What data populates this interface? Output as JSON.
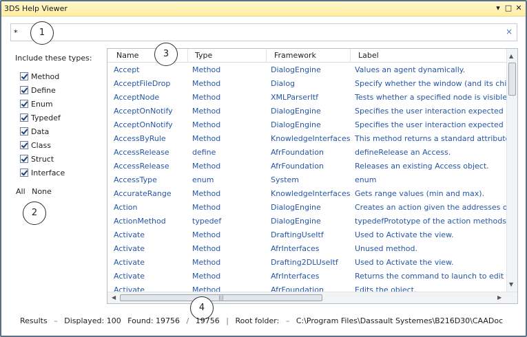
{
  "window": {
    "title": "3DS Help Viewer",
    "pin_glyph": "▾",
    "maximize_glyph": "□",
    "close_glyph": "✕"
  },
  "search": {
    "value": "*",
    "clear_glyph": "×"
  },
  "filters": {
    "title": "Include these types:",
    "types": [
      {
        "label": "Method",
        "checked": true
      },
      {
        "label": "Define",
        "checked": true
      },
      {
        "label": "Enum",
        "checked": true
      },
      {
        "label": "Typedef",
        "checked": true
      },
      {
        "label": "Data",
        "checked": true
      },
      {
        "label": "Class",
        "checked": true
      },
      {
        "label": "Struct",
        "checked": true
      },
      {
        "label": "Interface",
        "checked": true
      }
    ],
    "all_label": "All",
    "none_label": "None"
  },
  "callouts": [
    "1",
    "2",
    "3",
    "4"
  ],
  "grid": {
    "columns": [
      "Name",
      "Type",
      "Framework",
      "Label"
    ],
    "rows": [
      [
        "Accept",
        "Method",
        "DialogEngine",
        "Values an agent dynamically."
      ],
      [
        "AcceptFileDrop",
        "Method",
        "Dialog",
        "Specify whether the window (and its child"
      ],
      [
        "AcceptNode",
        "Method",
        "XMLParserItf",
        "Tests whether a specified node is visible ir"
      ],
      [
        "AcceptOnNotify",
        "Method",
        "DialogEngine",
        "Specifies the user interaction expected by"
      ],
      [
        "AcceptOnNotify",
        "Method",
        "DialogEngine",
        "Specifies the user interaction expected by"
      ],
      [
        "AccessByRule",
        "Method",
        "KnowledgeInterfaces",
        "This method returns a standard attribute a"
      ],
      [
        "AccessRelease",
        "define",
        "AfrFoundation",
        "defineRelease an Access."
      ],
      [
        "AccessRelease",
        "Method",
        "AfrFoundation",
        "Releases an existing Access object."
      ],
      [
        "AccessType",
        "enum",
        "System",
        "enum"
      ],
      [
        "AccurateRange",
        "Method",
        "KnowledgeInterfaces",
        "Gets range values (min and max)."
      ],
      [
        "Action",
        "Method",
        "DialogEngine",
        "Creates an action given the addresses of t"
      ],
      [
        "ActionMethod",
        "typedef",
        "DialogEngine",
        "typedefPrototype of the action methods."
      ],
      [
        "Activate",
        "Method",
        "DraftingUseItf",
        "Used to Activate the view."
      ],
      [
        "Activate",
        "Method",
        "AfrInterfaces",
        "Unused method."
      ],
      [
        "Activate",
        "Method",
        "Drafting2DLUseItf",
        "Used to Activate the view."
      ],
      [
        "Activate",
        "Method",
        "AfrInterfaces",
        "Returns the command to launch to edit th"
      ],
      [
        "Activate",
        "Method",
        "AfrFoundation",
        "Edits the object."
      ]
    ],
    "hscroll_grip": "|||"
  },
  "status": {
    "results_label": "Results",
    "dash": "–",
    "displayed": "Displayed: 100",
    "found": "Found: 19756",
    "slash": "/",
    "total": "19756",
    "root_label": "Root folder:",
    "root_path": "C:\\Program Files\\Dassault Systemes\\B216D30\\CAADoc"
  },
  "colors": {
    "title_bar": "#ffeda3",
    "link_text": "#2456a8",
    "border": "#5b6f86"
  }
}
